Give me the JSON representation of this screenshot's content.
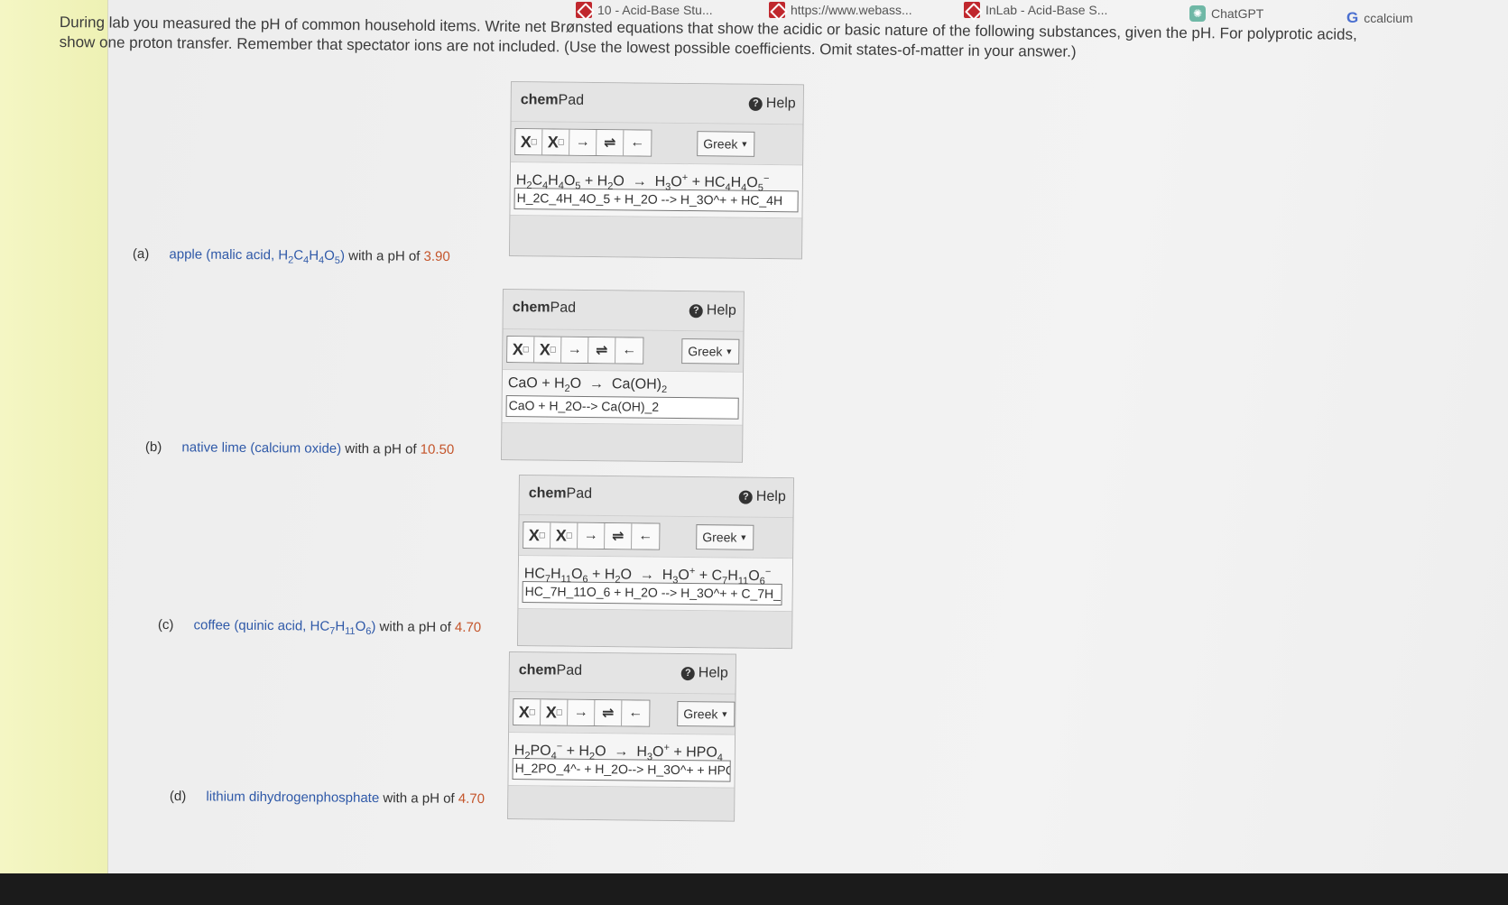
{
  "bookmarks": [
    {
      "label": "10 - Acid-Base Stu...",
      "icon": "webassign-icon"
    },
    {
      "label": "https://www.webass...",
      "icon": "webassign-icon"
    },
    {
      "label": "InLab - Acid-Base S...",
      "icon": "webassign-icon"
    },
    {
      "label": "ChatGPT",
      "icon": "chatgpt-icon"
    },
    {
      "label": "ccalcium",
      "icon": "google-icon"
    }
  ],
  "instructions": {
    "line1": "During lab you measured the pH of common household items. Write net Brønsted equations that show the acidic or basic nature of the following substances, given the pH. For polyprotic acids,",
    "line2": "show one proton transfer. Remember that spectator ions are not included. (Use the lowest possible coefficients. Omit states-of-matter in your answer.)"
  },
  "chempad": {
    "title_bold": "chem",
    "title_rest": "Pad",
    "help": "Help",
    "greek": "Greek",
    "tools": [
      "X□",
      "X□",
      "→",
      "⇌",
      "←"
    ]
  },
  "questions": [
    {
      "letter": "(a)",
      "desc_pre": "apple (malic acid, H",
      "desc_mid": "C",
      "desc_mid2": "H",
      "desc_mid3": "O",
      "ph_text": "with a pH of",
      "ph_value": "3.90",
      "input": "H_2C_4H_4O_5 + H_2O --> H_3O^+ + HC_4H"
    },
    {
      "letter": "(b)",
      "desc": "native lime (calcium oxide)",
      "ph_text": "with a pH of",
      "ph_value": "10.50",
      "input": "CaO + H_2O--> Ca(OH)_2"
    },
    {
      "letter": "(c)",
      "ph_text": "with a pH of",
      "ph_value": "4.70",
      "input": "HC_7H_11O_6 + H_2O --> H_3O^+ + C_7H_"
    },
    {
      "letter": "(d)",
      "desc": "lithium dihydrogenphosphate",
      "ph_text": "with a pH of",
      "ph_value": "4.70",
      "input": "H_2PO_4^- + H_2O--> H_3O^+ + HPO"
    }
  ]
}
